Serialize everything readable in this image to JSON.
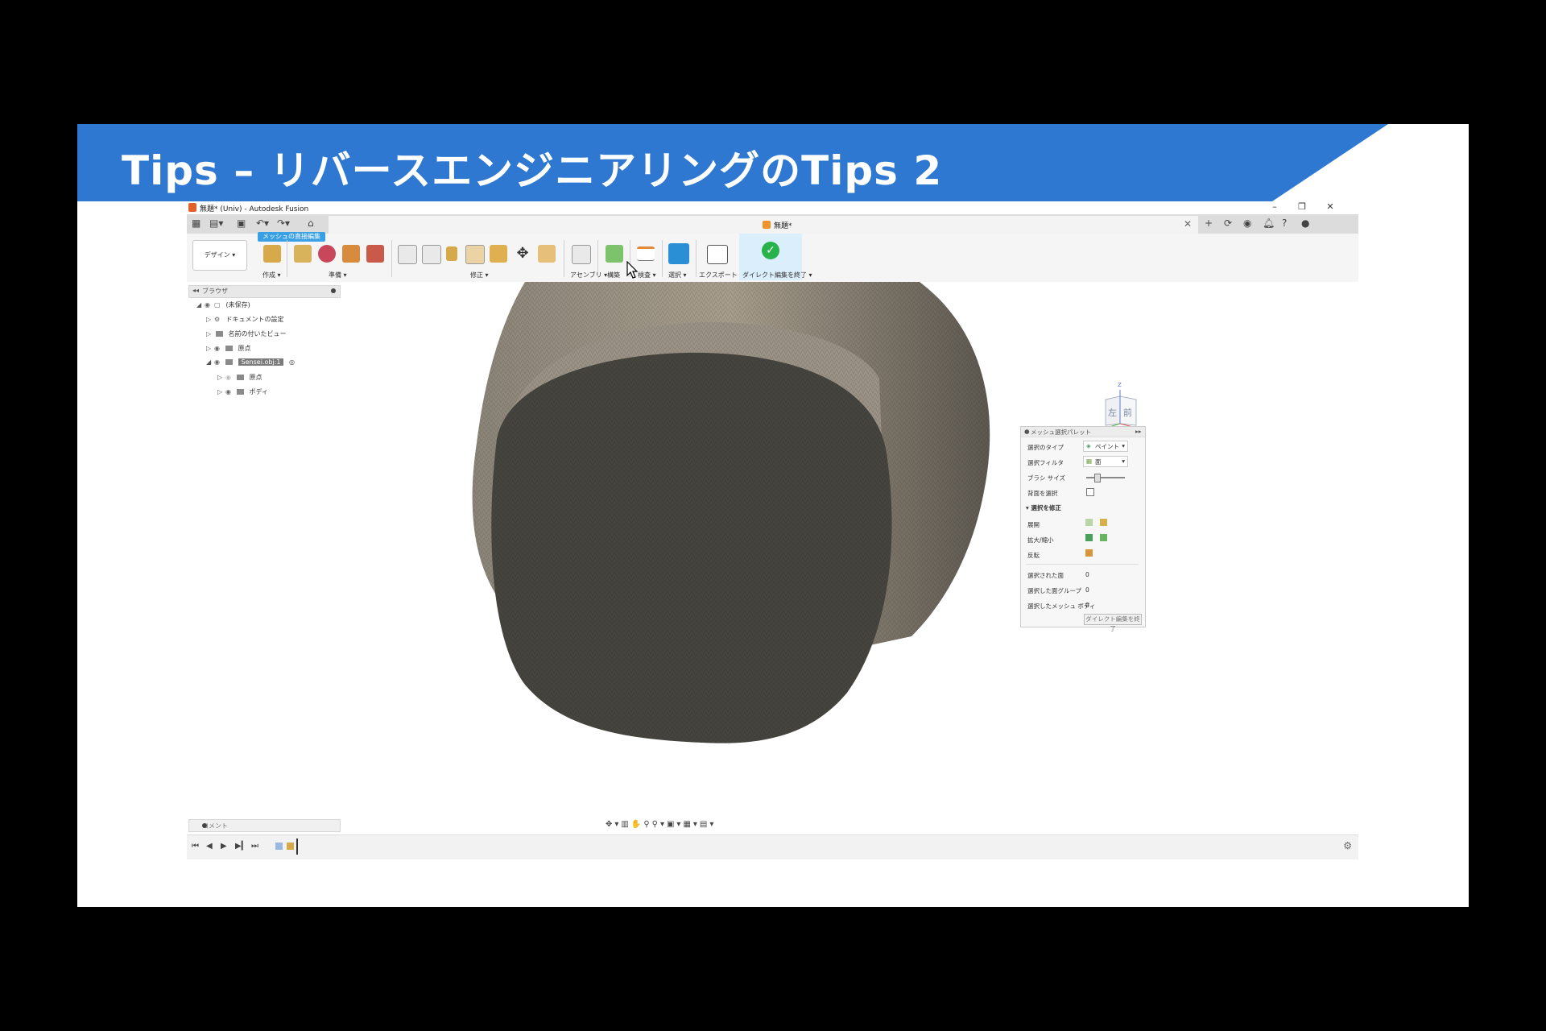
{
  "slide": {
    "title": "Tips – リバースエンジニアリングのTips 2",
    "colors": {
      "banner": "#2e78d2",
      "background": "#000000"
    }
  },
  "window": {
    "title": "無題* (Univ) - Autodesk Fusion",
    "document_tab": "無題*"
  },
  "ribbon": {
    "workspace_button": "デザイン ▾",
    "tooltip": "メッシュの直接編集",
    "groups": {
      "create": "作成 ▾",
      "prepare": "準備 ▾",
      "modify": "修正 ▾",
      "assemble": "アセンブリ ▾",
      "construct": "構築",
      "inspect": "検査 ▾",
      "select": "選択 ▾",
      "export": "エクスポート ▾",
      "finish": "ダイレクト編集を終了 ▾"
    }
  },
  "browser": {
    "label": "ブラウザ",
    "items": [
      {
        "label": "(未保存)"
      },
      {
        "label": "ドキュメントの設定"
      },
      {
        "label": "名前の付いたビュー"
      },
      {
        "label": "原点"
      },
      {
        "label": "Sensei.obj:1"
      },
      {
        "label": "原点"
      },
      {
        "label": "ボディ"
      }
    ]
  },
  "palette": {
    "header": "メッシュ選択パレット",
    "select_type_label": "選択のタイプ",
    "select_type_value": "ペイント",
    "select_filter_label": "選択フィルタ",
    "select_filter_value": "面",
    "brush_size_label": "ブラシ サイズ",
    "backface_label": "背面を選択",
    "modify_section": "選択を修正",
    "expand_label": "展開",
    "grow_shrink_label": "拡大/縮小",
    "invert_label": "反転",
    "selected_faces_label": "選択された面",
    "selected_faces_value": "0",
    "selected_groups_label": "選択した面グループ",
    "selected_groups_value": "0",
    "selected_bodies_label": "選択したメッシュ ボディ",
    "selected_bodies_value": "0",
    "finish_button": "ダイレクト編集を終了"
  },
  "viewcube": {
    "left_face": "左",
    "front_face": "前",
    "z_axis": "Z",
    "x_axis": "X"
  },
  "comments": {
    "label": "コメント"
  },
  "icons": [
    "grid-icon",
    "file-icon",
    "save-icon",
    "undo-icon",
    "redo-icon",
    "home-icon",
    "plus-icon",
    "sync-icon",
    "notification-icon",
    "help-icon",
    "user-icon",
    "gear-icon"
  ]
}
